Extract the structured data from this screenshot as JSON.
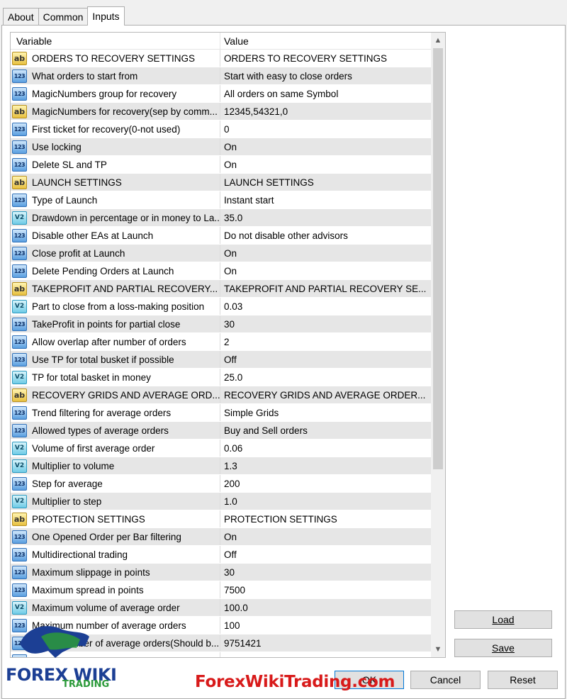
{
  "tabs": [
    {
      "label": "About"
    },
    {
      "label": "Common"
    },
    {
      "label": "Inputs",
      "active": true
    }
  ],
  "grid": {
    "headers": {
      "variable": "Variable",
      "value": "Value"
    },
    "rows": [
      {
        "type": "ab",
        "variable": "ORDERS TO RECOVERY SETTINGS",
        "value": "ORDERS TO RECOVERY SETTINGS"
      },
      {
        "type": "num",
        "variable": "What orders to start from",
        "value": "Start with easy to close orders"
      },
      {
        "type": "num",
        "variable": "MagicNumbers group for recovery",
        "value": "All orders on same Symbol"
      },
      {
        "type": "ab",
        "variable": "MagicNumbers for recovery(sep by comm...",
        "value": "12345,54321,0"
      },
      {
        "type": "num",
        "variable": "First ticket for recovery(0-not used)",
        "value": "0"
      },
      {
        "type": "num",
        "variable": "Use locking",
        "value": "On"
      },
      {
        "type": "num",
        "variable": "Delete SL and TP",
        "value": "On"
      },
      {
        "type": "ab",
        "variable": "LAUNCH SETTINGS",
        "value": "LAUNCH SETTINGS"
      },
      {
        "type": "num",
        "variable": "Type of Launch",
        "value": "Instant start"
      },
      {
        "type": "dbl",
        "variable": "Drawdown in percentage or in money to La...",
        "value": "35.0"
      },
      {
        "type": "num",
        "variable": "Disable other EAs at Launch",
        "value": "Do not disable other advisors"
      },
      {
        "type": "num",
        "variable": "Close profit at Launch",
        "value": "On"
      },
      {
        "type": "num",
        "variable": "Delete Pending Orders at Launch",
        "value": "On"
      },
      {
        "type": "ab",
        "variable": "TAKEPROFIT AND PARTIAL RECOVERY...",
        "value": "TAKEPROFIT AND PARTIAL RECOVERY SE..."
      },
      {
        "type": "dbl",
        "variable": "Part to close from a loss-making position",
        "value": "0.03"
      },
      {
        "type": "num",
        "variable": "TakeProfit in points for partial close",
        "value": "30"
      },
      {
        "type": "num",
        "variable": "Allow overlap after number of orders",
        "value": "2"
      },
      {
        "type": "num",
        "variable": "Use TP for total busket if possible",
        "value": "Off"
      },
      {
        "type": "dbl",
        "variable": "TP for total basket in money",
        "value": "25.0"
      },
      {
        "type": "ab",
        "variable": "RECOVERY GRIDS AND AVERAGE ORD...",
        "value": "RECOVERY GRIDS AND AVERAGE ORDER..."
      },
      {
        "type": "num",
        "variable": "Trend filtering for average orders",
        "value": "Simple Grids"
      },
      {
        "type": "num",
        "variable": "Allowed types of average orders",
        "value": "Buy and Sell orders"
      },
      {
        "type": "dbl",
        "variable": "Volume of first average order",
        "value": "0.06"
      },
      {
        "type": "dbl",
        "variable": "Multiplier to volume",
        "value": "1.3"
      },
      {
        "type": "num",
        "variable": "Step for average",
        "value": "200"
      },
      {
        "type": "dbl",
        "variable": "Multiplier to step",
        "value": "1.0"
      },
      {
        "type": "ab",
        "variable": "PROTECTION SETTINGS",
        "value": "PROTECTION SETTINGS"
      },
      {
        "type": "num",
        "variable": "One Opened Order per Bar filtering",
        "value": "On"
      },
      {
        "type": "num",
        "variable": "Multidirectional trading",
        "value": "Off"
      },
      {
        "type": "num",
        "variable": "Maximum slippage in points",
        "value": "30"
      },
      {
        "type": "num",
        "variable": "Maximum spread in points",
        "value": "7500"
      },
      {
        "type": "dbl",
        "variable": "Maximum volume of average order",
        "value": "100.0"
      },
      {
        "type": "num",
        "variable": "Maximum number of average orders",
        "value": "100"
      },
      {
        "type": "num",
        "variable": "Magic number of average orders(Should b...",
        "value": "9751421"
      },
      {
        "type": "num",
        "variable": "",
        "value": ""
      }
    ]
  },
  "icons": {
    "ab": "ab",
    "num": "123",
    "dbl": "V2"
  },
  "buttons": {
    "load": "Load",
    "save": "Save",
    "ok": "OK",
    "cancel": "Cancel",
    "reset": "Reset"
  },
  "watermark": {
    "brand_top": "FOREX WIKI",
    "brand_bottom": "TRADING",
    "site": "ForexWikiTrading.com"
  }
}
